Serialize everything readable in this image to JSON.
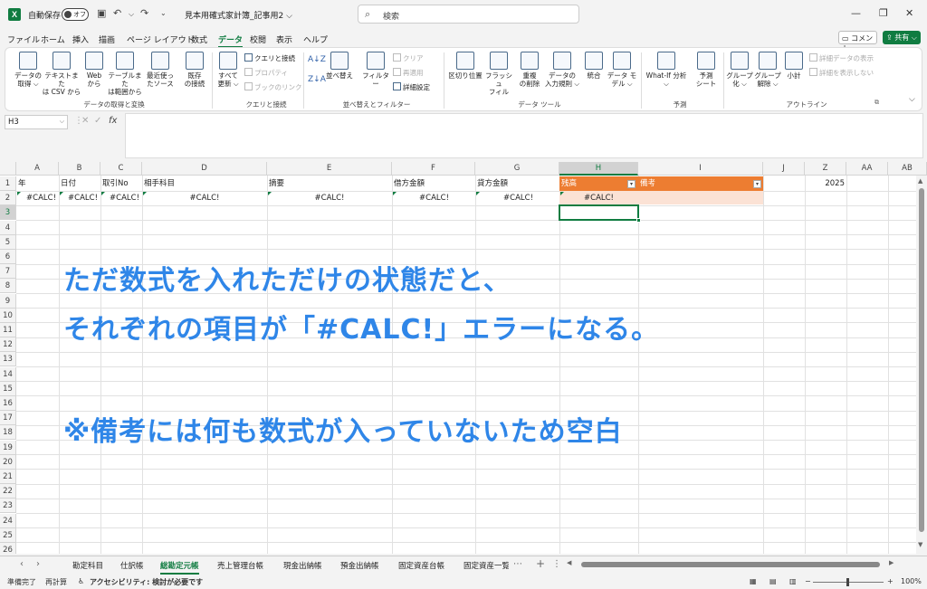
{
  "titlebar": {
    "logo": "X",
    "autosave_label": "自動保存",
    "autosave_state": "オフ",
    "doc_title": "見本用確式家計簿_記事用2 ⌵",
    "search_placeholder": "検索"
  },
  "menu": {
    "tabs": [
      "ファイル",
      "ホーム",
      "挿入",
      "描画",
      "ページ レイアウト",
      "数式",
      "データ",
      "校閲",
      "表示",
      "ヘルプ"
    ],
    "active_tab": "データ",
    "comment_label": "コメント",
    "share_label": "共有"
  },
  "ribbon": {
    "get_data": [
      {
        "label1": "データの",
        "label2": "取得 ⌵"
      },
      {
        "label1": "テキストまた",
        "label2": "は CSV から"
      },
      {
        "label1": "Web",
        "label2": "から"
      },
      {
        "label1": "テーブルまた",
        "label2": "は範囲から"
      },
      {
        "label1": "最近使っ",
        "label2": "たソース"
      },
      {
        "label1": "既存",
        "label2": "の接続"
      }
    ],
    "group1_label": "データの取得と変換",
    "refresh_label1": "すべて",
    "refresh_label2": "更新 ⌵",
    "queries_items": [
      "クエリと接続",
      "プロパティ",
      "ブックのリンク"
    ],
    "group2_label": "クエリと接続",
    "sort_label": "並べ替え",
    "filter_label": "フィルター",
    "filter_items": [
      "クリア",
      "再適用",
      "詳細設定"
    ],
    "group3_label": "並べ替えとフィルター",
    "tools": [
      {
        "label1": "区切り位置",
        "label2": ""
      },
      {
        "label1": "フラッシュ",
        "label2": "フィル"
      },
      {
        "label1": "重複",
        "label2": "の削除"
      },
      {
        "label1": "データの",
        "label2": "入力規則 ⌵"
      },
      {
        "label1": "統合",
        "label2": ""
      },
      {
        "label1": "データ モ",
        "label2": "デル ⌵"
      }
    ],
    "group4_label": "データ ツール",
    "forecast": [
      {
        "label1": "What-If 分析",
        "label2": "⌵"
      },
      {
        "label1": "予測",
        "label2": "シート"
      }
    ],
    "group5_label": "予測",
    "outline": [
      {
        "label1": "グループ",
        "label2": "化 ⌵"
      },
      {
        "label1": "グループ",
        "label2": "解除 ⌵"
      },
      {
        "label1": "小計",
        "label2": ""
      }
    ],
    "outline_items": [
      "詳細データの表示",
      "詳細を表示しない"
    ],
    "group6_label": "アウトライン"
  },
  "formula": {
    "name_box": "H3",
    "fx": "fx",
    "cancel": "✕",
    "enter": "✓"
  },
  "grid": {
    "columns": [
      "A",
      "B",
      "C",
      "D",
      "E",
      "F",
      "G",
      "H",
      "I",
      "J",
      "Z",
      "AA",
      "AB"
    ],
    "selected_column": "H",
    "rows": [
      "1",
      "2",
      "3",
      "4",
      "5",
      "6",
      "7",
      "8",
      "9",
      "10",
      "11",
      "12",
      "13",
      "14",
      "15",
      "16",
      "17",
      "18",
      "19",
      "20",
      "21",
      "22",
      "23",
      "24",
      "25",
      "26"
    ],
    "selected_row": "3",
    "headers": [
      "年",
      "日付",
      "取引No",
      "相手科目",
      "摘要",
      "借方金額",
      "貸方金額",
      "残高",
      "備考"
    ],
    "z1_value": "2025",
    "calc_error": "#CALC!",
    "dropdown_glyph": "▾"
  },
  "annotation": {
    "line1": "ただ数式を入れただけの状態だと、",
    "line2": "それぞれの項目が「#CALC!」エラーになる。",
    "line3": "※備考には何も数式が入っていないため空白",
    "color": "#2f86e8"
  },
  "sheets": {
    "tabs": [
      "勘定科目",
      "仕訳帳",
      "総勘定元帳",
      "売上管理台帳",
      "現金出納帳",
      "預金出納帳",
      "固定資産台帳",
      "固定資産一覧"
    ],
    "active": "総勘定元帳",
    "add": "+"
  },
  "status": {
    "ready": "準備完了",
    "recalc": "再計算",
    "accessibility": "アクセシビリティ: 検討が必要です",
    "zoom": "100%"
  },
  "colors": {
    "accent": "#107c41",
    "header_orange": "#ed7d31",
    "row_peach": "#fbe2d5"
  }
}
